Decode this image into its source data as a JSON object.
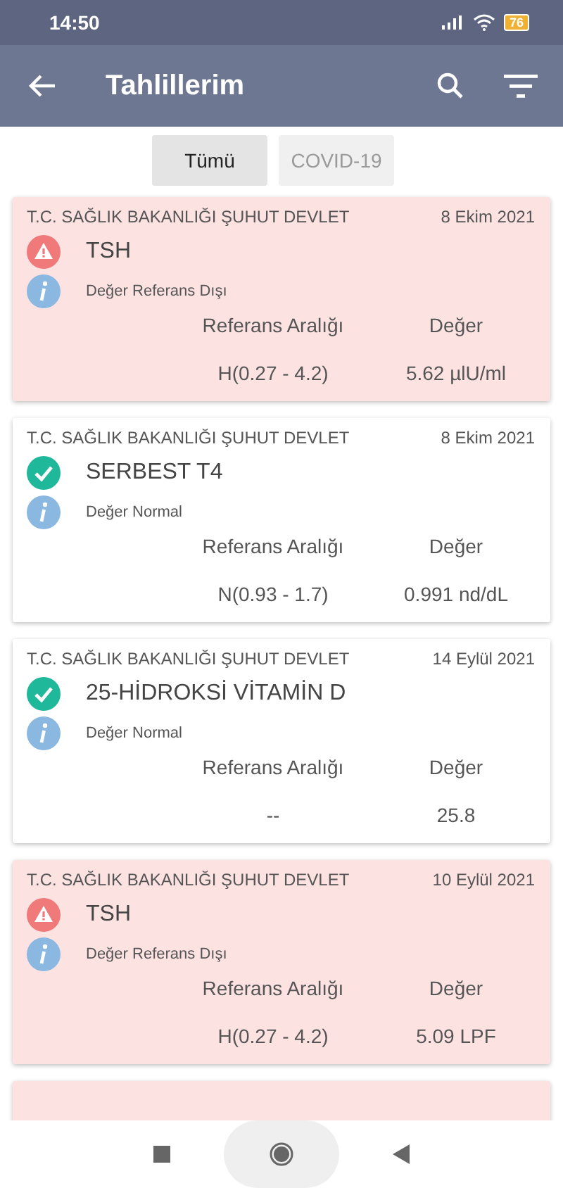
{
  "status_bar": {
    "time": "14:50",
    "battery": "76"
  },
  "app_bar": {
    "title": "Tahlillerim"
  },
  "tabs": [
    {
      "label": "Tümü",
      "selected": true
    },
    {
      "label": "COVID-19",
      "selected": false
    }
  ],
  "results": [
    {
      "hospital": "T.C. SAĞLIK BAKANLIĞI ŞUHUT DEVLET",
      "date": "8 Ekim 2021",
      "test": "TSH",
      "abnormal": true,
      "note": "Değer Referans Dışı",
      "range_header": "Referans Aralığı",
      "value_header": "Değer",
      "range": "H(0.27 - 4.2)",
      "value": "5.62 µlU/ml"
    },
    {
      "hospital": "T.C. SAĞLIK BAKANLIĞI ŞUHUT DEVLET",
      "date": "8 Ekim 2021",
      "test": "SERBEST T4",
      "abnormal": false,
      "note": "Değer Normal",
      "range_header": "Referans Aralığı",
      "value_header": "Değer",
      "range": "N(0.93 - 1.7)",
      "value": "0.991 nd/dL"
    },
    {
      "hospital": "T.C. SAĞLIK BAKANLIĞI ŞUHUT DEVLET",
      "date": "14 Eylül 2021",
      "test": "25-HİDROKSİ VİTAMİN D",
      "abnormal": false,
      "note": "Değer Normal",
      "range_header": "Referans Aralığı",
      "value_header": "Değer",
      "range": "--",
      "value": "25.8"
    },
    {
      "hospital": "T.C. SAĞLIK BAKANLIĞI ŞUHUT DEVLET",
      "date": "10 Eylül 2021",
      "test": "TSH",
      "abnormal": true,
      "note": "Değer Referans Dışı",
      "range_header": "Referans Aralığı",
      "value_header": "Değer",
      "range": "H(0.27 - 4.2)",
      "value": "5.09 LPF"
    }
  ],
  "partial_result": {
    "abnormal": true
  }
}
